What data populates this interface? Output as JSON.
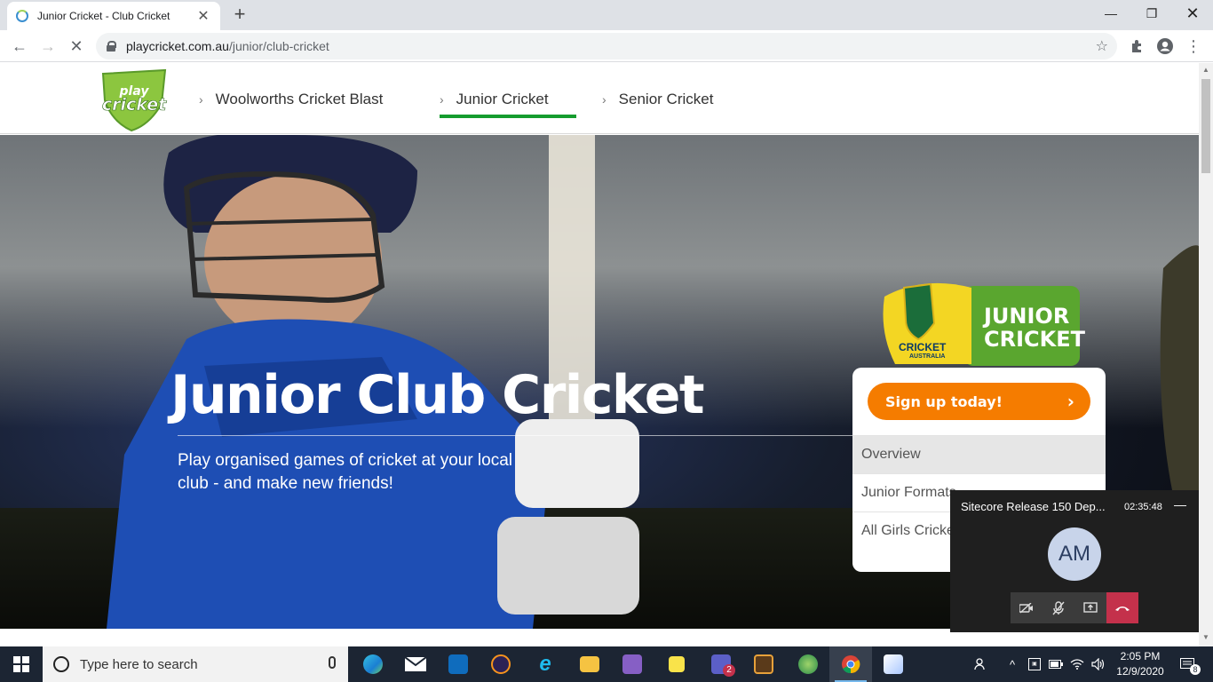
{
  "browser": {
    "tab_title": "Junior Cricket - Club Cricket",
    "url_host": "playcricket.com.au",
    "url_path": "/junior/club-cricket"
  },
  "site": {
    "logo_text": "play cricket",
    "nav": [
      {
        "label": "Woolworths Cricket Blast"
      },
      {
        "label": "Junior Cricket"
      },
      {
        "label": "Senior Cricket"
      }
    ],
    "active_nav": "Junior Cricket"
  },
  "hero": {
    "title": "Junior Club Cricket",
    "subtitle": "Play organised games of cricket at your local club - and make new friends!"
  },
  "side_panel": {
    "badge_brand": "CRICKET",
    "badge_brand_sub": "AUSTRALIA",
    "badge_title_1": "JUNIOR",
    "badge_title_2": "CRICKET",
    "signup_label": "Sign up today!",
    "items": [
      {
        "label": "Overview"
      },
      {
        "label": "Junior Formats"
      },
      {
        "label": "All Girls Cricket"
      }
    ]
  },
  "call": {
    "title": "Sitecore Release 150 Dep...",
    "duration": "02:35:48",
    "avatar_initials": "AM"
  },
  "taskbar": {
    "search_placeholder": "Type here to search",
    "time": "2:05 PM",
    "date": "12/9/2020",
    "notification_count": "8",
    "teams_badge": "2"
  },
  "colors": {
    "nav_active_underline": "#159c2e",
    "signup_orange": "#f57c00",
    "hangup_red": "#c4314b"
  }
}
